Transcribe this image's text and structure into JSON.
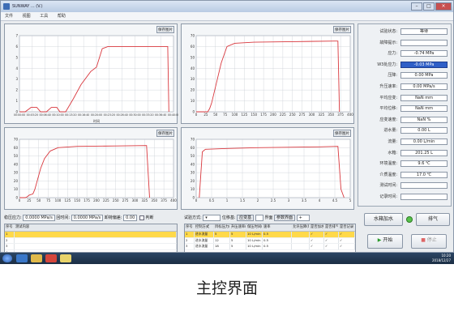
{
  "window": {
    "title": "SUNWAY   ...  (V.)"
  },
  "menu": [
    "文件",
    "视图",
    "工具",
    "帮助"
  ],
  "charts": [
    {
      "save_label": "保存图片",
      "xlabel": "时间",
      "ylabel": "",
      "xticks": [
        "00:00:00",
        "00:03:20",
        "00:06:40",
        "00:10:00",
        "00:13:20",
        "00:16:40",
        "00:20:00",
        "00:23:20",
        "00:26:40",
        "00:30:00",
        "00:33:20",
        "00:36:40",
        "00:40:00"
      ],
      "yticks": [
        "0",
        "1",
        "2",
        "3",
        "4",
        "5",
        "6",
        "7"
      ]
    },
    {
      "save_label": "保存图片",
      "xlabel": "",
      "ylabel": "",
      "xticks": [
        "0",
        "25",
        "50",
        "75",
        "100",
        "125",
        "150",
        "175",
        "200",
        "225",
        "250",
        "275",
        "300",
        "325",
        "350",
        "375",
        "400"
      ],
      "yticks": [
        "0",
        "10",
        "20",
        "30",
        "40",
        "50",
        "60",
        "70"
      ]
    },
    {
      "save_label": "保存图片",
      "xlabel": "",
      "ylabel": "",
      "xticks": [
        "0",
        "25",
        "50",
        "75",
        "100",
        "125",
        "150",
        "175",
        "200",
        "225",
        "250",
        "275",
        "300",
        "325",
        "350",
        "375",
        "400"
      ],
      "yticks": [
        "0",
        "10",
        "20",
        "30",
        "40",
        "50",
        "60",
        "70"
      ]
    },
    {
      "save_label": "保存图片",
      "xlabel": "",
      "ylabel": "",
      "xticks": [
        "0",
        "0.5",
        "1",
        "1.5",
        "2",
        "2.5",
        "3",
        "3.5",
        "4",
        "4.5",
        "5"
      ],
      "yticks": [
        "0",
        "10",
        "20",
        "30",
        "40",
        "50",
        "60",
        "70"
      ]
    }
  ],
  "chart_data": [
    {
      "type": "line",
      "xlabel": "时间",
      "ylabel": "",
      "ylim": [
        0,
        7
      ],
      "xlim_minutes": [
        0,
        40
      ],
      "series": [
        {
          "points": [
            [
              0,
              0
            ],
            [
              1.5,
              0
            ],
            [
              3,
              0.4
            ],
            [
              4.5,
              0.4
            ],
            [
              5.5,
              0
            ],
            [
              7,
              0
            ],
            [
              8.3,
              0.4
            ],
            [
              9.7,
              0.4
            ],
            [
              10.5,
              0
            ],
            [
              12,
              0
            ],
            [
              14,
              1.2
            ],
            [
              16,
              2.5
            ],
            [
              18.5,
              3.7
            ],
            [
              20,
              4.1
            ],
            [
              21.5,
              5.8
            ],
            [
              23,
              6.0
            ],
            [
              25,
              6.0
            ],
            [
              30,
              6.0
            ],
            [
              36,
              6.0
            ],
            [
              38.5,
              6.0
            ],
            [
              38.8,
              0
            ]
          ]
        }
      ]
    },
    {
      "type": "line",
      "xlabel": "",
      "ylabel": "",
      "ylim": [
        0,
        70
      ],
      "xlim": [
        0,
        400
      ],
      "series": [
        {
          "points": [
            [
              0,
              0
            ],
            [
              30,
              0
            ],
            [
              35,
              3
            ],
            [
              40,
              8
            ],
            [
              55,
              30
            ],
            [
              65,
              45
            ],
            [
              80,
              60
            ],
            [
              100,
              63
            ],
            [
              150,
              64
            ],
            [
              250,
              64.5
            ],
            [
              360,
              65
            ],
            [
              368,
              65
            ],
            [
              372,
              0
            ]
          ]
        }
      ]
    },
    {
      "type": "line",
      "xlabel": "",
      "ylabel": "",
      "ylim": [
        0,
        70
      ],
      "xlim": [
        0,
        400
      ],
      "series": [
        {
          "points": [
            [
              0,
              0
            ],
            [
              15,
              0
            ],
            [
              20,
              1
            ],
            [
              25,
              3
            ],
            [
              35,
              4.5
            ],
            [
              40,
              10
            ],
            [
              55,
              35
            ],
            [
              65,
              47
            ],
            [
              80,
              56
            ],
            [
              100,
              60
            ],
            [
              150,
              61.5
            ],
            [
              250,
              62
            ],
            [
              330,
              62.5
            ],
            [
              338,
              0
            ]
          ]
        }
      ]
    },
    {
      "type": "line",
      "xlabel": "",
      "ylabel": "",
      "ylim": [
        0,
        70
      ],
      "xlim": [
        0,
        5
      ],
      "series": [
        {
          "points": [
            [
              0.1,
              0
            ],
            [
              0.15,
              28
            ],
            [
              0.2,
              55
            ],
            [
              0.3,
              58
            ],
            [
              1,
              59
            ],
            [
              2,
              60
            ],
            [
              3,
              60.5
            ],
            [
              4,
              61
            ],
            [
              4.6,
              61.5
            ],
            [
              4.7,
              10
            ],
            [
              4.8,
              0
            ]
          ]
        }
      ]
    }
  ],
  "right_panel": [
    {
      "label": "试验状态:",
      "value": "等待",
      "highlight": false
    },
    {
      "label": "故障提示:",
      "value": "",
      "highlight": false
    },
    {
      "label": "应力:",
      "value": "-0.74 MPa",
      "highlight": false
    },
    {
      "label": "W3处应力:",
      "value": "-0.03 MPa",
      "highlight": true
    },
    {
      "label": "压降:",
      "value": "0.00 MPa",
      "highlight": false
    },
    {
      "label": "升压速率:",
      "value": "0.00 MPa/s",
      "highlight": false
    },
    {
      "label": "平均应变:",
      "value": "NaN mm",
      "highlight": false
    },
    {
      "label": "平均位移:",
      "value": "NaN mm",
      "highlight": false
    },
    {
      "label": "应变速度:",
      "value": "NaN %",
      "highlight": false
    },
    {
      "label": "进水量:",
      "value": "0.00 L",
      "highlight": false
    },
    {
      "label": "流量:",
      "value": "0.00 L/min",
      "highlight": false
    },
    {
      "label": "水箱:",
      "value": "201.25 L",
      "highlight": false
    },
    {
      "label": "环境温度:",
      "value": "9.6 ℃",
      "highlight": false
    },
    {
      "label": "介质温度:",
      "value": "17.0 ℃",
      "highlight": false
    },
    {
      "label": "测试时间:",
      "value": "",
      "highlight": false
    },
    {
      "label": "记录时间:",
      "value": "",
      "highlight": false
    }
  ],
  "options_left": {
    "label1": "稳压应力:",
    "val1": "0.0000 MPa/s",
    "label2": "回时间:",
    "val2": "0.0000 MPa/s",
    "label3": "卸荷偏差:",
    "val3": "0.00",
    "check_label": "判断"
  },
  "options_right": {
    "label1": "试验方式:",
    "label2": "位移基:",
    "btn1": "应变基",
    "label3": "界面",
    "btn2": "参数界面"
  },
  "table_left": {
    "headers": [
      "序号",
      "测试内容"
    ],
    "rows": [
      [
        "1",
        ""
      ],
      [
        "2",
        ""
      ],
      [
        "3",
        ""
      ],
      [
        "4",
        ""
      ],
      [
        "5",
        ""
      ]
    ]
  },
  "table_right": {
    "headers": [
      "序号",
      "控制方式",
      "目标压力(MPa)",
      "升压速率(MPa/s)",
      "保压时间(min)",
      "速率",
      "允许压降(MPa)",
      "是否加水",
      "是否排气",
      "是否记录"
    ],
    "rows": [
      [
        "1",
        "进水流量",
        "5",
        "5",
        "10 L/min",
        "0.5",
        "",
        "✓",
        "✓",
        "✓"
      ],
      [
        "2",
        "进水流量",
        "12",
        "5",
        "10 L/min",
        "0.5",
        "",
        "✓",
        "✓",
        "✓"
      ],
      [
        "3",
        "进水流量",
        "18",
        "5",
        "10 L/min",
        "0.5",
        "",
        "✓",
        "✓",
        "✓"
      ]
    ]
  },
  "buttons": {
    "water": "水箱加水",
    "exhaust": "排气",
    "start": "开始",
    "stop": "停止"
  },
  "tray": {
    "time": "10:20",
    "date": "2018/12/27"
  },
  "caption": "主控界面",
  "colors": {
    "curve": "#d9383e",
    "grid": "#c9ced6",
    "highlight": "#2f5fc7",
    "selected_row": "#ffd94a"
  }
}
